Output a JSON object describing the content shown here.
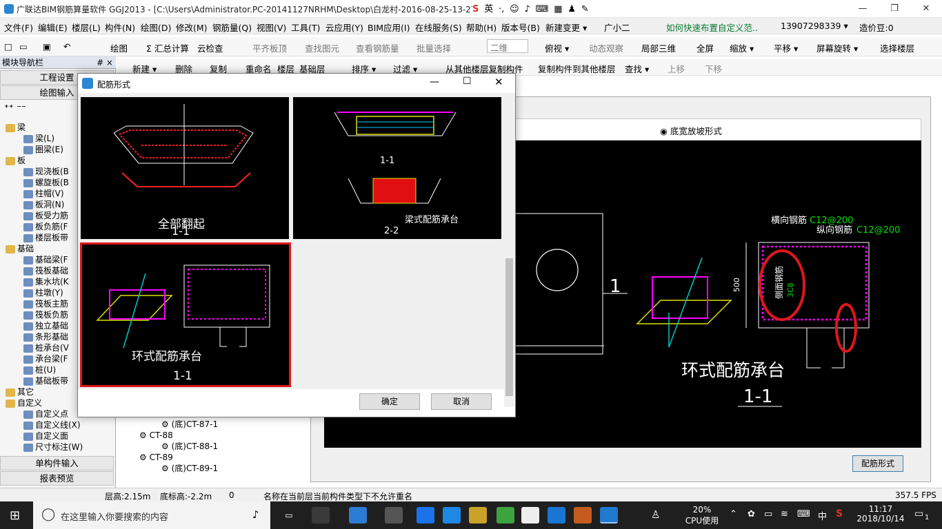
{
  "titlebar": {
    "title": "广联达BIM钢筋算量软件 GGJ2013 - [C:\\Users\\Administrator.PC-20141127NRHM\\Desktop\\白龙村-2016-08-25-13-27",
    "ime_label": "英",
    "minimize": "—",
    "restore": "❐",
    "close": "✕"
  },
  "menubar": {
    "items": [
      "文件(F)",
      "编辑(E)",
      "楼层(L)",
      "构件(N)",
      "绘图(D)",
      "修改(M)",
      "钢筋量(Q)",
      "视图(V)",
      "工具(T)",
      "云应用(Y)",
      "BIM应用(I)",
      "在线服务(S)",
      "帮助(H)",
      "版本号(B)",
      "新建变更 ▾",
      "广小二",
      "如何快速布置自定义范..",
      "13907298339 ▾",
      "造价豆:0"
    ]
  },
  "toolbar1": {
    "items": [
      "绘图",
      "Σ 汇总计算",
      "云检查",
      "平齐板顶",
      "查找图元",
      "查看钢筋量",
      "批量选择",
      "二维",
      "俯视 ▾",
      "动态观察",
      "局部三维",
      "全屏",
      "缩放 ▾",
      "平移 ▾",
      "屏幕旋转 ▾",
      "选择楼层"
    ]
  },
  "toolbar2": {
    "items": [
      "新建 ▾",
      "删除",
      "复制",
      "重命名",
      "楼层",
      "基础层",
      "排序 ▾",
      "过滤 ▾",
      "从其他楼层复制构件",
      "复制构件到其他楼层",
      "查找 ▾",
      "上移",
      "下移"
    ]
  },
  "leftpanel": {
    "header": "模块导航栏",
    "pin": "# ×",
    "btn_settings": "工程设置",
    "btn_draw": "绘图输入",
    "tree": [
      {
        "label": "梁",
        "level": 0,
        "folder": true
      },
      {
        "label": "梁(L)",
        "level": 1
      },
      {
        "label": "圈梁(E)",
        "level": 1
      },
      {
        "label": "板",
        "level": 0,
        "folder": true
      },
      {
        "label": "现浇板(B",
        "level": 1
      },
      {
        "label": "螺旋板(B",
        "level": 1
      },
      {
        "label": "柱帽(V)",
        "level": 1
      },
      {
        "label": "板洞(N)",
        "level": 1
      },
      {
        "label": "板受力筋",
        "level": 1
      },
      {
        "label": "板负筋(F",
        "level": 1
      },
      {
        "label": "楼层板带",
        "level": 1
      },
      {
        "label": "基础",
        "level": 0,
        "folder": true
      },
      {
        "label": "基础梁(F",
        "level": 1
      },
      {
        "label": "筏板基础",
        "level": 1
      },
      {
        "label": "集水坑(K",
        "level": 1
      },
      {
        "label": "柱墩(Y)",
        "level": 1
      },
      {
        "label": "筏板主筋",
        "level": 1
      },
      {
        "label": "筏板负筋",
        "level": 1
      },
      {
        "label": "独立基础",
        "level": 1
      },
      {
        "label": "条形基础",
        "level": 1
      },
      {
        "label": "桩承台(V",
        "level": 1
      },
      {
        "label": "承台梁(F",
        "level": 1
      },
      {
        "label": "桩(U)",
        "level": 1
      },
      {
        "label": "基础板带",
        "level": 1
      },
      {
        "label": "其它",
        "level": 0,
        "folder": true
      },
      {
        "label": "自定义",
        "level": 0,
        "folder": true
      },
      {
        "label": "自定义点",
        "level": 1
      },
      {
        "label": "自定义线(X)",
        "level": 1
      },
      {
        "label": "自定义面",
        "level": 1
      },
      {
        "label": "尺寸标注(W)",
        "level": 1
      }
    ],
    "btn_single": "单构件输入",
    "btn_report": "报表预览"
  },
  "midtree": [
    {
      "label": "(底)CT-87-1",
      "level": 1
    },
    {
      "label": "CT-88",
      "level": 0
    },
    {
      "label": "(底)CT-88-1",
      "level": 1
    },
    {
      "label": "CT-89",
      "level": 0
    },
    {
      "label": "(底)CT-89-1",
      "level": 1
    }
  ],
  "rightpanel": {
    "radio_label": "底宽放坡形式",
    "caption_title": "环式配筋承台",
    "caption_section": "1-1",
    "dim_label": "1",
    "heng": "横向钢筋",
    "heng_spec": "C12@200",
    "zong": "纵向钢筋",
    "zong_spec": "C12@200",
    "side": "侧面钢筋",
    "side_spec": "3C8",
    "height": "500",
    "btn_peijin": "配筋形式"
  },
  "dialog": {
    "title": "配筋形式",
    "cells": [
      {
        "caption": "全部翻起",
        "section": "1-1",
        "selected": false
      },
      {
        "caption": "梁式配筋承台",
        "section": "1-1",
        "section2": "2-2",
        "selected": false
      },
      {
        "caption": "环式配筋承台",
        "section": "1-1",
        "selected": true
      }
    ],
    "ok": "确定",
    "cancel": "取消"
  },
  "statusbar": {
    "floor_height": "层高:2.15m",
    "base_height": "底标高:-2.2m",
    "zero": "0",
    "message": "名称在当前层当前构件类型下不允许重名",
    "fps": "357.5 FPS"
  },
  "taskbar": {
    "search_placeholder": "在这里输入你要搜索的内容",
    "cpu_pct": "20%",
    "cpu_label": "CPU使用",
    "lang": "中",
    "time": "11:17",
    "date": "2018/10/14",
    "notif_count": "1"
  }
}
